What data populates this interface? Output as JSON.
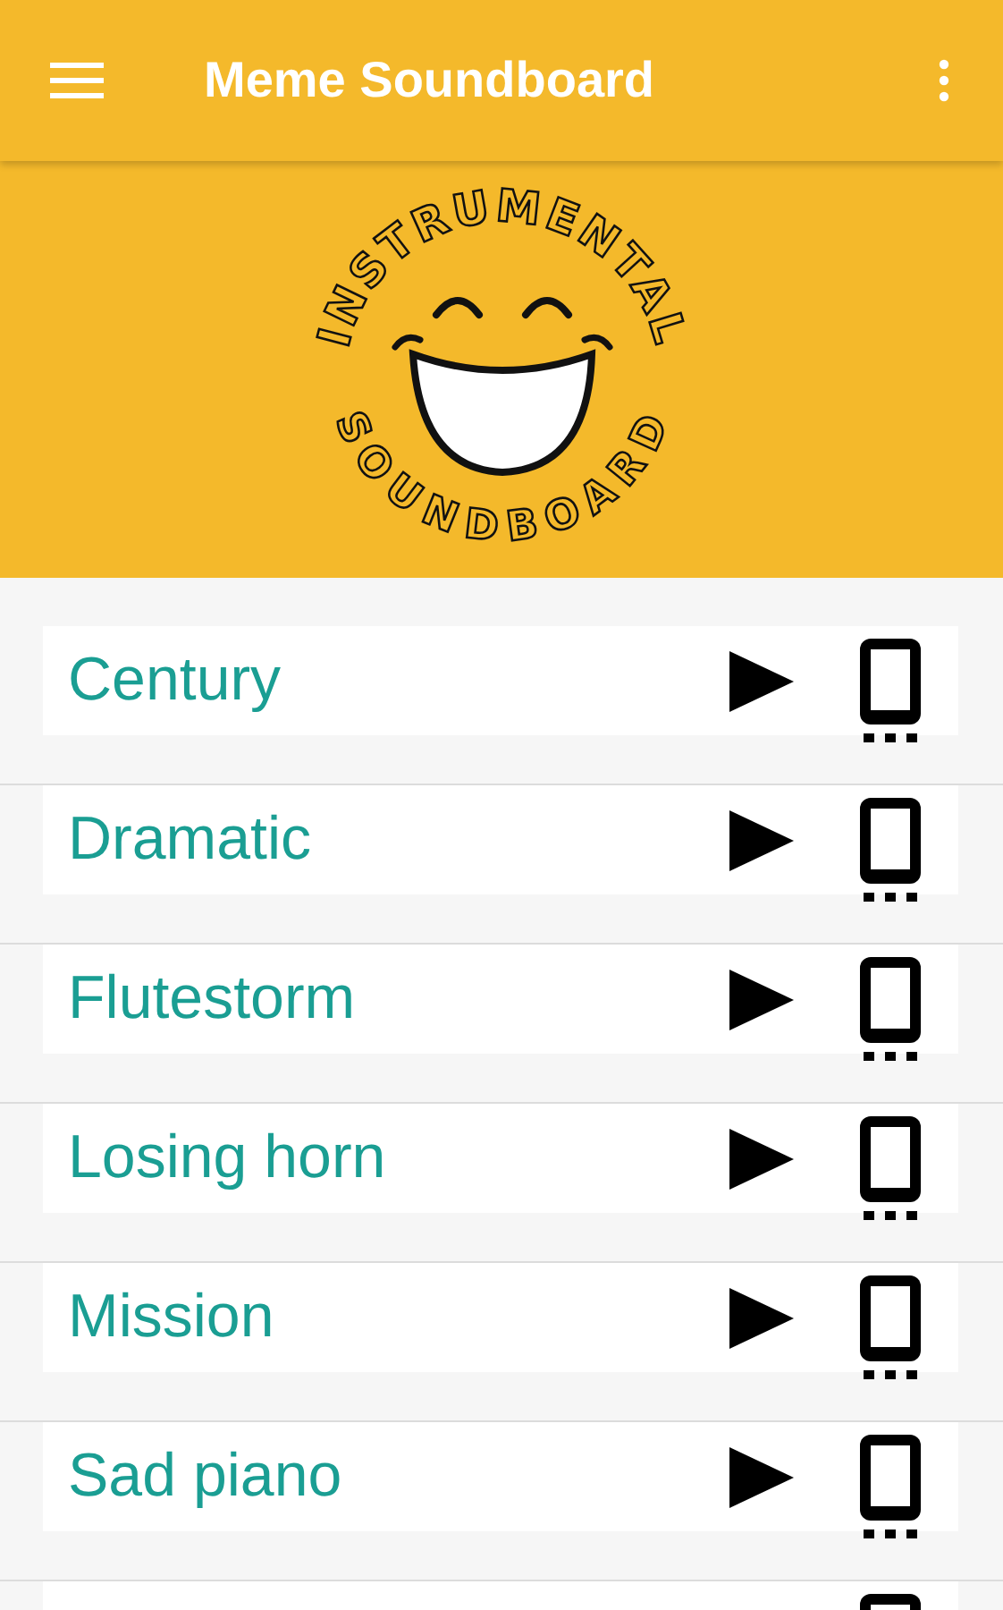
{
  "app_bar": {
    "title": "Meme Soundboard"
  },
  "logo": {
    "top_text": "INSTRUMENTAL",
    "bottom_text": "SOUNDBOARD"
  },
  "sounds": [
    {
      "title": "Century"
    },
    {
      "title": "Dramatic"
    },
    {
      "title": "Flutestorm"
    },
    {
      "title": "Losing horn"
    },
    {
      "title": "Mission"
    },
    {
      "title": "Sad piano"
    }
  ]
}
